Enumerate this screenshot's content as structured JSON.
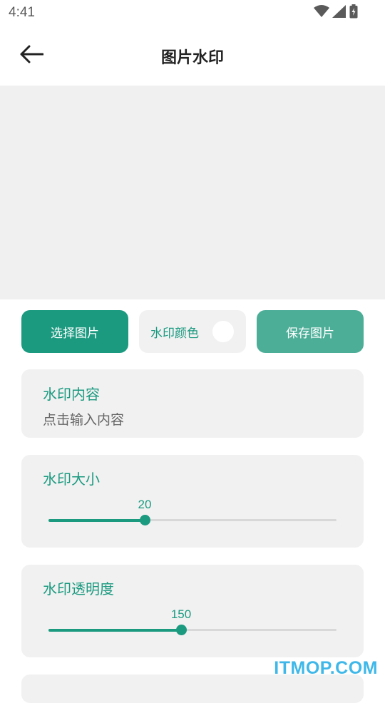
{
  "status": {
    "time": "4:41",
    "icons": [
      "wifi-icon",
      "cell-signal-icon",
      "battery-charging-icon"
    ]
  },
  "appbar": {
    "title": "图片水印",
    "back_icon": "back-arrow-icon"
  },
  "actions": {
    "select_label": "选择图片",
    "color_label": "水印颜色",
    "color_value": "#ffffff",
    "save_label": "保存图片"
  },
  "content_card": {
    "label": "水印内容",
    "placeholder": "点击输入内容"
  },
  "size_card": {
    "label": "水印大小",
    "value": "20",
    "fraction": 0.333
  },
  "opacity_card": {
    "label": "水印透明度",
    "value": "150",
    "fraction": 0.46
  },
  "watermark": "ITMOP.COM",
  "colors": {
    "accent": "#1b9a80",
    "accent_light": "#4dae98",
    "card_bg": "#f1f1f1"
  }
}
